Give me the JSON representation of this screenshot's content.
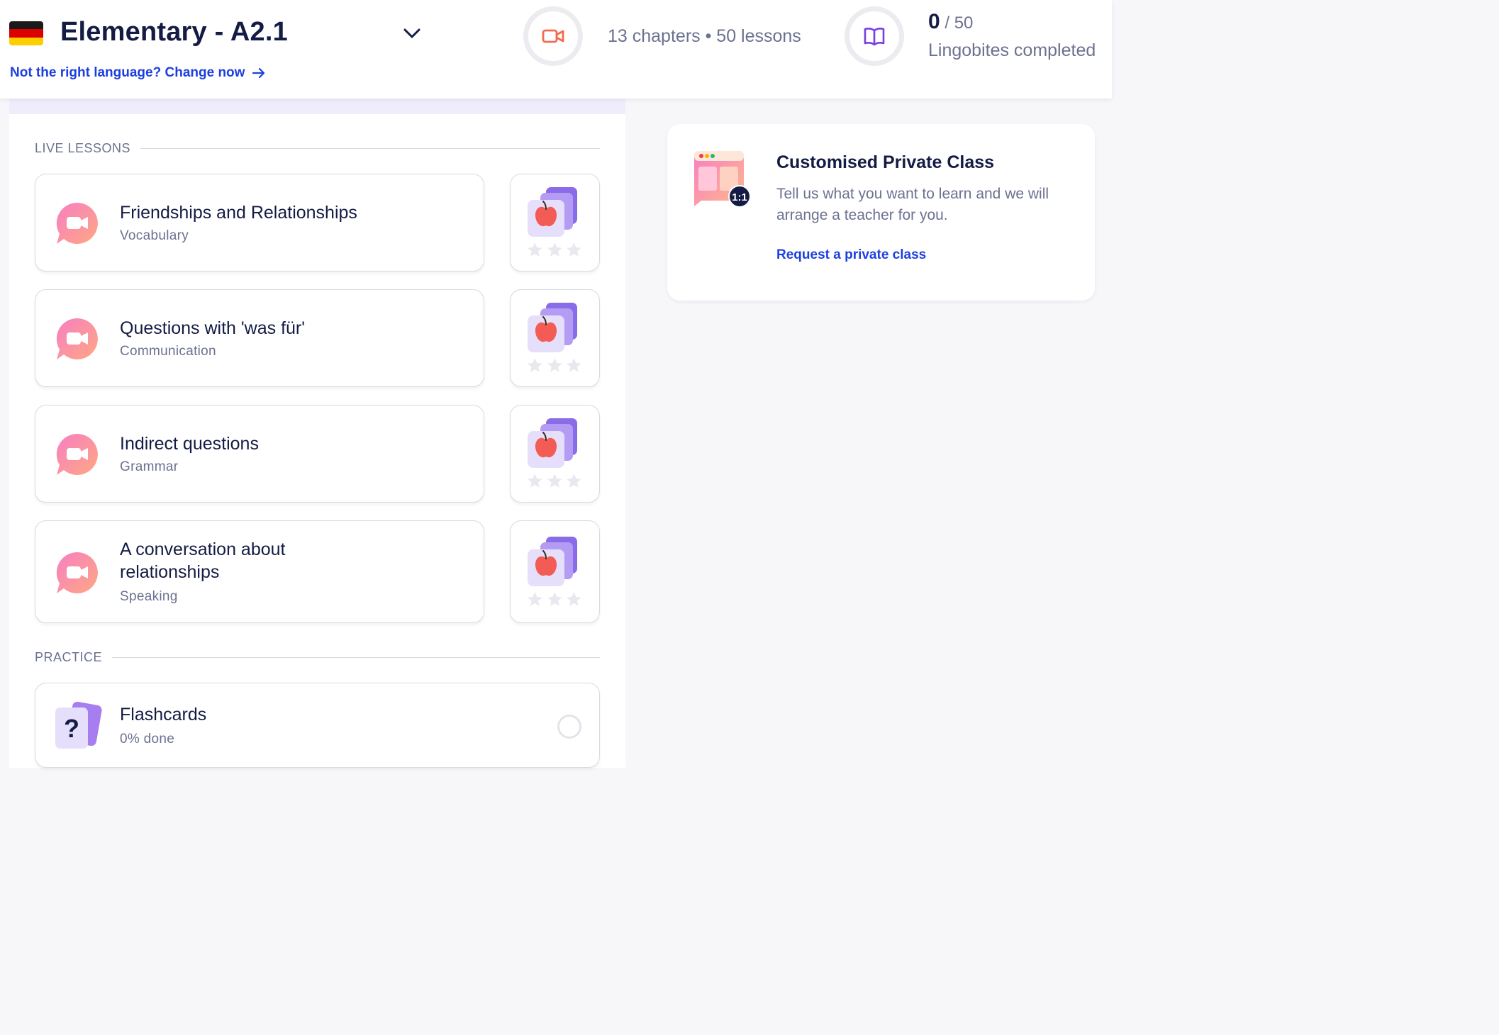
{
  "header": {
    "flag_colors": [
      "#1a1a1a",
      "#dd0000",
      "#ffce00"
    ],
    "course_title": "Elementary - A2.1",
    "change_link": "Not the right language? Change now",
    "stats": "13 chapters • 50 lessons",
    "progress_done": "0",
    "progress_total": "/ 50",
    "progress_label": "Lingobites completed"
  },
  "live_lessons": {
    "label": "LIVE LESSONS",
    "items": [
      {
        "title": "Friendships and Relationships",
        "category": "Vocabulary",
        "stars": 0
      },
      {
        "title": "Questions with 'was für'",
        "category": "Communication",
        "stars": 0
      },
      {
        "title": "Indirect questions",
        "category": "Grammar",
        "stars": 0
      },
      {
        "title_line1": "A conversation about",
        "title_line2": "relationships",
        "category": "Speaking",
        "stars": 0
      }
    ]
  },
  "practice": {
    "label": "PRACTICE",
    "flashcards": {
      "title": "Flashcards",
      "progress": "0% done"
    }
  },
  "private_class": {
    "title": "Customised Private Class",
    "description": "Tell us what you want to learn and we will arrange a teacher for you.",
    "badge": "1:1",
    "link": "Request a private class"
  },
  "colors": {
    "accent_blue": "#1d3fe0",
    "navy": "#141b44",
    "muted": "#6b7190",
    "video_orange": "#f26b4f",
    "book_purple": "#7a3de0"
  }
}
